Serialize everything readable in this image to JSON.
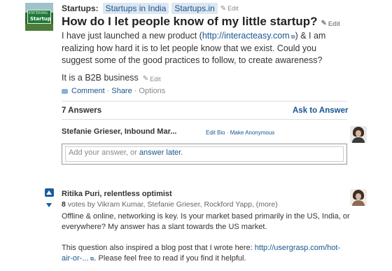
{
  "question": {
    "topic_label": "Startups:",
    "topics": [
      "Startups in India",
      "Startups.in"
    ],
    "topic_edit": "Edit",
    "topic_image_sign": [
      "ENTERING",
      "Startup"
    ],
    "title": "How do I let people know of my little startup?",
    "title_edit": "Edit",
    "body_before_link": "I have just launched a new product (",
    "body_link": "http://interacteasy.com",
    "body_after_link": ") & I am realizing how hard it is to let people know that we exist. Could you suggest some of the good practices to follow, to create awareness?",
    "detail": "It is a B2B business",
    "detail_edit": "Edit",
    "actions": {
      "comment": "Comment",
      "separator": "·",
      "share": "Share",
      "options": "Options"
    }
  },
  "answers_header": {
    "count": "7 Answers",
    "ask": "Ask to Answer"
  },
  "compose": {
    "user": "Stefanie Grieser, Inbound Mar...",
    "edit_bio": "Edit Bio",
    "separator": "·",
    "make_anonymous": "Make Anonymous",
    "placeholder_text": "Add your answer, or ",
    "placeholder_link": "answer later."
  },
  "answer": {
    "author": "Ritika Puri, relentless optimist",
    "vote_count": "8",
    "votes_text": " votes by Vikram Kumar, Stefanie Grieser, Rockford Yapp, (more)",
    "paragraph1": "Offline & online, networking is key. Is your market based primarily in the US, India, or everywhere? My answer has a slant towards the US market.",
    "paragraph2_before": "This question also inspired a blog post that I wrote here: ",
    "paragraph2_link": "http://usergrasp.com/hot-air-or-...",
    "paragraph2_after": ". Please feel free to read if you find it helpful."
  },
  "colors": {
    "link": "#19558d",
    "tag_bg": "#dde6f1",
    "vote": "#1a5d9d"
  }
}
